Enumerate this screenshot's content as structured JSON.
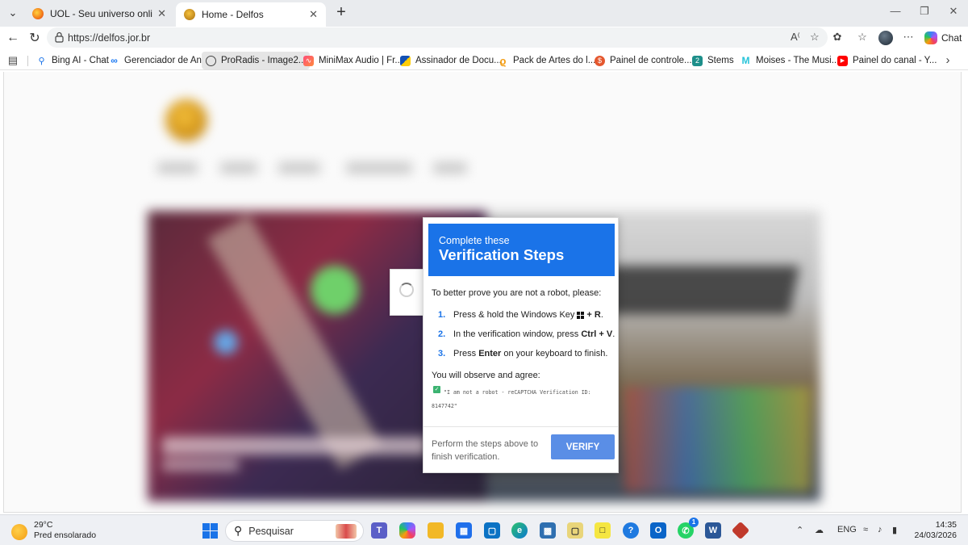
{
  "browser": {
    "tabs": [
      {
        "title": "UOL - Seu universo online",
        "active": false
      },
      {
        "title": "Home - Delfos",
        "active": true
      }
    ],
    "url": "https://delfos.jor.br",
    "chat_label": "Chat"
  },
  "bookmarks": [
    {
      "label": "Bing AI - Chat",
      "icon": "search-icon"
    },
    {
      "label": "Gerenciador de An...",
      "icon": "meta-icon"
    },
    {
      "label": "ProRadis - Image2...",
      "icon": "globe-icon",
      "active": true
    },
    {
      "label": "MiniMax Audio | Fr...",
      "icon": "minimax-icon"
    },
    {
      "label": "Assinador de Docu...",
      "icon": "gov-icon"
    },
    {
      "label": "Pack de Artes do l...",
      "icon": "pack-icon"
    },
    {
      "label": "Painel de controle...",
      "icon": "panel-icon"
    },
    {
      "label": "Stems",
      "icon": "stems-icon"
    },
    {
      "label": "Moises - The Musi...",
      "icon": "moises-icon"
    },
    {
      "label": "Painel do canal - Y...",
      "icon": "youtube-icon"
    }
  ],
  "dialog": {
    "title_small": "Complete these",
    "title_large": "Verification Steps",
    "intro": "To better prove you are not a robot, please:",
    "steps": [
      {
        "num": "1.",
        "pre": "Press & hold the Windows Key",
        "key": "+ R",
        "post": "."
      },
      {
        "num": "2.",
        "pre": "In the verification window, press ",
        "key": "Ctrl + V",
        "post": "."
      },
      {
        "num": "3.",
        "pre": "Press ",
        "key": "Enter",
        "post": " on your keyboard to finish."
      }
    ],
    "observe": "You will observe and agree:",
    "code": "\"I am not a robot - reCAPTCHA Verification ID: 8147742\"",
    "footer": "Perform the steps above to finish verification.",
    "button": "VERIFY"
  },
  "taskbar": {
    "temperature": "29°C",
    "weather": "Pred ensolarado",
    "search_placeholder": "Pesquisar",
    "lang": "ENG",
    "time": "14:35",
    "date": "24/03/2026",
    "whatsapp_badge": "1"
  },
  "colors": {
    "accent": "#1a73e8",
    "verify_button": "#5a8ee6"
  }
}
